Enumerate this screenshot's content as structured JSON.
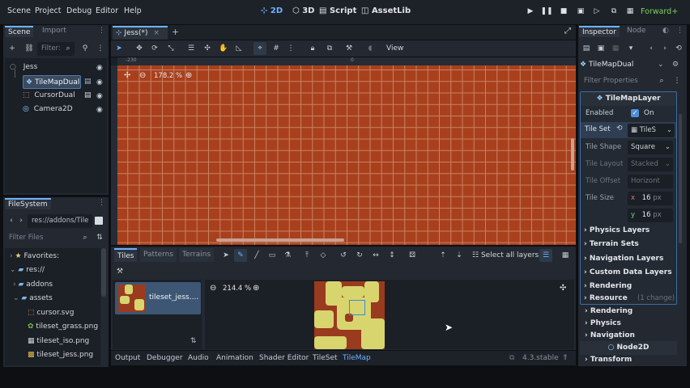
{
  "menu": [
    "Scene",
    "Project",
    "Debug",
    "Editor",
    "Help"
  ],
  "workspaces": [
    {
      "label": "2D",
      "icon": "2d-icon"
    },
    {
      "label": "3D",
      "icon": "3d-icon"
    },
    {
      "label": "Script",
      "icon": "script-icon"
    },
    {
      "label": "AssetLib",
      "icon": "assetlib-icon"
    }
  ],
  "renderer": "Forward+",
  "scene_dock": {
    "tabs": [
      "Scene",
      "Import"
    ],
    "filter_placeholder": "Filter:",
    "nodes": [
      {
        "name": "Jess",
        "icon": "node2d-icon",
        "depth": 0
      },
      {
        "name": "TileMapDual",
        "icon": "tilemap-icon",
        "depth": 1,
        "selected": true
      },
      {
        "name": "CursorDual",
        "icon": "cursor-icon",
        "depth": 1
      },
      {
        "name": "Camera2D",
        "icon": "camera-icon",
        "depth": 1
      }
    ]
  },
  "filesystem": {
    "tab": "FileSystem",
    "path": "res://addons/Tile",
    "filter_placeholder": "Filter Files",
    "items": [
      {
        "name": "Favorites:",
        "icon": "star-icon",
        "depth": 0
      },
      {
        "name": "res://",
        "icon": "folder-icon",
        "depth": 0
      },
      {
        "name": "addons",
        "icon": "folder-icon",
        "depth": 1
      },
      {
        "name": "assets",
        "icon": "folder-icon",
        "depth": 1
      },
      {
        "name": "cursor.svg",
        "icon": "svg-file-icon",
        "depth": 2
      },
      {
        "name": "tileset_grass.png",
        "icon": "image-file-icon",
        "depth": 2
      },
      {
        "name": "tileset_iso.png",
        "icon": "image-file-icon",
        "depth": 2
      },
      {
        "name": "tileset_jess.png",
        "icon": "image-file-icon",
        "depth": 2
      }
    ]
  },
  "scene_tab": "Jess(*)",
  "viewport": {
    "zoom": "178.2 %",
    "ruler_marks": [
      "-230",
      "0"
    ],
    "view_label": "View"
  },
  "tilemap_panel": {
    "tabs": [
      "Tiles",
      "Patterns",
      "Terrains"
    ],
    "select_all": "Select all layers",
    "source_name": "tileset_jess....",
    "zoom": "214.4 %"
  },
  "bottom_tabs": [
    "Output",
    "Debugger",
    "Audio",
    "Animation",
    "Shader Editor",
    "TileSet",
    "TileMap"
  ],
  "version": "4.3.stable",
  "inspector": {
    "tabs": [
      "Inspector",
      "Node"
    ],
    "node_name": "TileMapDual",
    "filter_placeholder": "Filter Properties",
    "class": "TileMapLayer",
    "enabled_label": "Enabled",
    "enabled_value": "On",
    "tileset_label": "Tile Set",
    "tileset_value": "TileS",
    "props": [
      {
        "label": "Tile Shape",
        "value": "Square",
        "dim": false
      },
      {
        "label": "Tile Layout",
        "value": "Stacked",
        "dim": true
      },
      {
        "label": "Tile Offset",
        "value": "Horizont",
        "dim": true
      }
    ],
    "tile_size_label": "Tile Size",
    "tile_size": {
      "x": "16",
      "y": "16",
      "unit": "px"
    },
    "sections": [
      "Physics Layers",
      "Terrain Sets",
      "Navigation Layers",
      "Custom Data Layers",
      "Rendering"
    ],
    "resource_label": "Resource",
    "resource_changes": "(1 change)",
    "outer_sections": [
      "Rendering",
      "Physics",
      "Navigation"
    ],
    "node2d_label": "Node2D",
    "transform_label": "Transform"
  },
  "colors": {
    "accent": "#6db2ff",
    "viewport_bg": "#a8401e",
    "grid_line": "#c9825f",
    "tile_grass": "#d8d56f",
    "tile_dirt": "#9a3a1f"
  }
}
